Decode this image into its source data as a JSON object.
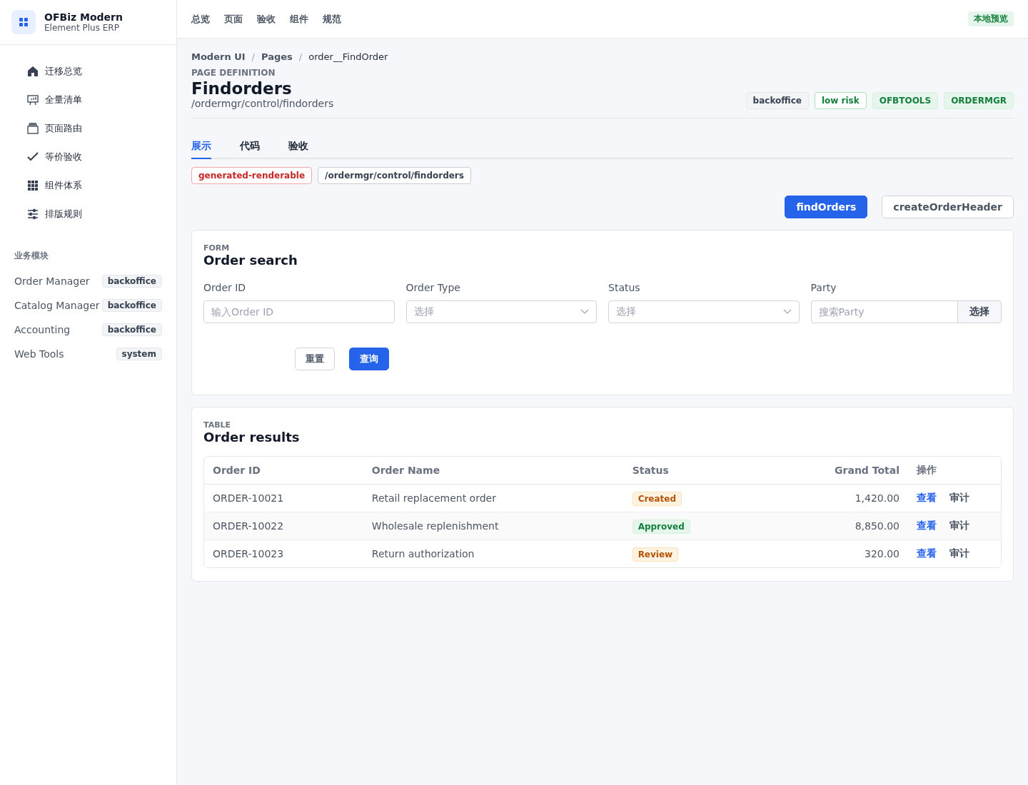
{
  "brand": {
    "title": "OFBiz Modern",
    "subtitle": "Element Plus ERP"
  },
  "nav": [
    {
      "label": "迁移总览"
    },
    {
      "label": "全量清单"
    },
    {
      "label": "页面路由"
    },
    {
      "label": "等价验收"
    },
    {
      "label": "组件体系"
    },
    {
      "label": "排版规则"
    }
  ],
  "modules": {
    "heading": "业务模块",
    "items": [
      {
        "label": "Order Manager",
        "tag": "backoffice"
      },
      {
        "label": "Catalog Manager",
        "tag": "backoffice"
      },
      {
        "label": "Accounting",
        "tag": "backoffice"
      },
      {
        "label": "Web Tools",
        "tag": "system"
      }
    ]
  },
  "topnav": [
    {
      "label": "总览"
    },
    {
      "label": "页面"
    },
    {
      "label": "验收"
    },
    {
      "label": "组件"
    },
    {
      "label": "规范"
    }
  ],
  "env_badge": "本地预览",
  "breadcrumb": [
    "Modern UI",
    "Pages",
    "order__FindOrder"
  ],
  "breadcrumb_separator": "/",
  "eyebrow": "PAGE DEFINITION",
  "title": "Findorders",
  "path": "/ordermgr/control/findorders",
  "header_tags": [
    {
      "label": "backoffice",
      "kind": "neutral"
    },
    {
      "label": "low risk",
      "kind": "outline"
    },
    {
      "label": "OFBTOOLS",
      "kind": "success"
    },
    {
      "label": "ORDERMGR",
      "kind": "success"
    }
  ],
  "tabs": [
    {
      "label": "展示",
      "selected": true
    },
    {
      "label": "代码",
      "selected": false
    },
    {
      "label": "验收",
      "selected": false
    }
  ],
  "info_tags": [
    {
      "label": "generated-renderable",
      "kind": "danger"
    },
    {
      "label": "/ordermgr/control/findorders",
      "kind": "plain"
    }
  ],
  "actions": [
    {
      "label": "findOrders",
      "kind": "primary"
    },
    {
      "label": "createOrderHeader",
      "kind": "default"
    }
  ],
  "form": {
    "eyebrow": "FORM",
    "title": "Order search",
    "fields": [
      {
        "label": "Order ID",
        "kind": "input",
        "placeholder": "输入Order ID"
      },
      {
        "label": "Order Type",
        "kind": "select",
        "placeholder": "选择"
      },
      {
        "label": "Status",
        "kind": "select",
        "placeholder": "选择"
      },
      {
        "label": "Party",
        "kind": "lookup",
        "placeholder": "搜索Party",
        "button": "选择"
      }
    ],
    "buttons": [
      {
        "label": "重置",
        "kind": "default"
      },
      {
        "label": "查询",
        "kind": "primary"
      }
    ]
  },
  "table": {
    "eyebrow": "TABLE",
    "title": "Order results",
    "columns": [
      "Order ID",
      "Order Name",
      "Status",
      "Grand Total",
      "操作"
    ],
    "rows": [
      {
        "id": "ORDER-10021",
        "name": "Retail replacement order",
        "status": {
          "label": "Created",
          "kind": "warning"
        },
        "total": "1,420.00",
        "actions": [
          "查看",
          "审计"
        ]
      },
      {
        "id": "ORDER-10022",
        "name": "Wholesale replenishment",
        "status": {
          "label": "Approved",
          "kind": "success"
        },
        "total": "8,850.00",
        "actions": [
          "查看",
          "审计"
        ]
      },
      {
        "id": "ORDER-10023",
        "name": "Return authorization",
        "status": {
          "label": "Review",
          "kind": "warning"
        },
        "total": "320.00",
        "actions": [
          "查看",
          "审计"
        ]
      }
    ]
  }
}
